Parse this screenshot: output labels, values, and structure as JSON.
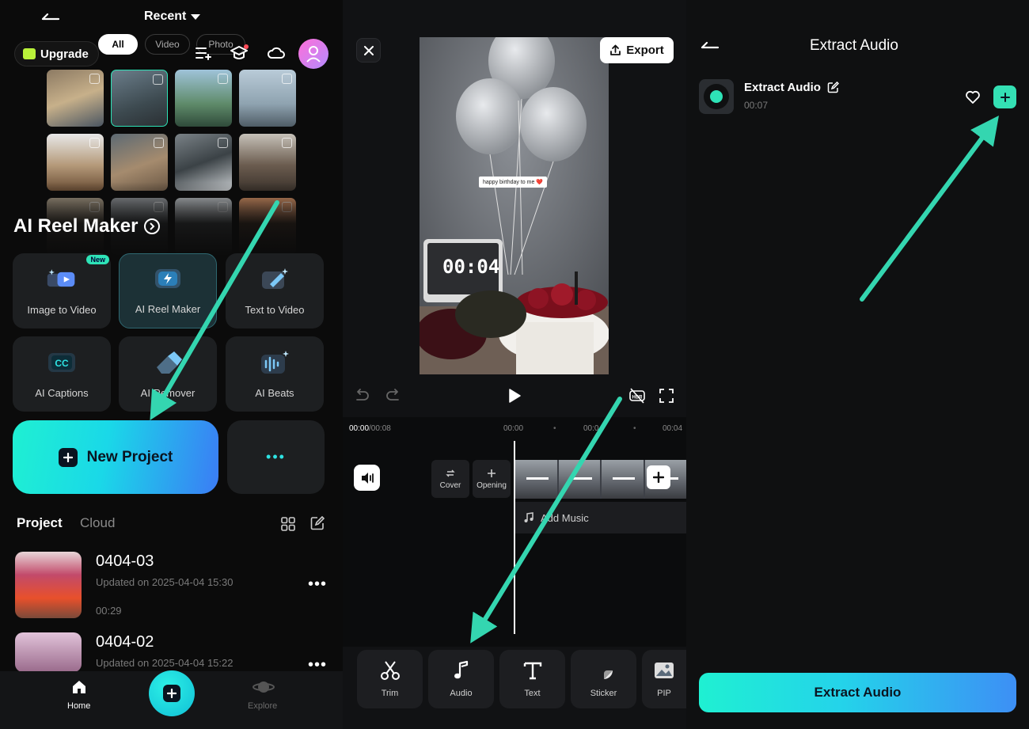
{
  "left": {
    "header_title": "Recent",
    "upgrade_label": "Upgrade",
    "filters": [
      "All",
      "Video",
      "Photo"
    ],
    "reel_section_title": "AI Reel Maker",
    "new_badge": "New",
    "features": [
      "Image to Video",
      "AI Reel Maker",
      "Text to Video",
      "AI Captions",
      "AI Remover",
      "AI Beats"
    ],
    "new_project_label": "New Project",
    "more_label": "•••",
    "tabs": {
      "project": "Project",
      "cloud": "Cloud"
    },
    "projects": [
      {
        "name": "0404-03",
        "updated": "Updated on 2025-04-04 15:30",
        "duration": "00:29"
      },
      {
        "name": "0404-02",
        "updated": "Updated on 2025-04-04 15:22"
      }
    ],
    "project_menu": "•••",
    "nav": {
      "home": "Home",
      "explore": "Explore"
    }
  },
  "middle": {
    "export_label": "Export",
    "sticker_text": "happy birthday to me ❤️",
    "clock_text": "00:04",
    "time_current": "00:00",
    "time_total": "/00:08",
    "ruler": [
      "00:00",
      "•",
      "00:0",
      "•",
      "00:04"
    ],
    "cover_label": "Cover",
    "opening_label": "Opening",
    "add_music_label": "Add Music",
    "tools": [
      "Trim",
      "Audio",
      "Text",
      "Sticker",
      "PIP"
    ]
  },
  "right": {
    "title": "Extract Audio",
    "item_name": "Extract Audio",
    "item_duration": "00:07",
    "button_label": "Extract Audio"
  },
  "colors": {
    "accent": "#2ee3b7",
    "arrow": "#34d6b0",
    "gradient_start": "#1ff0d2",
    "gradient_end": "#3b7cf5"
  }
}
